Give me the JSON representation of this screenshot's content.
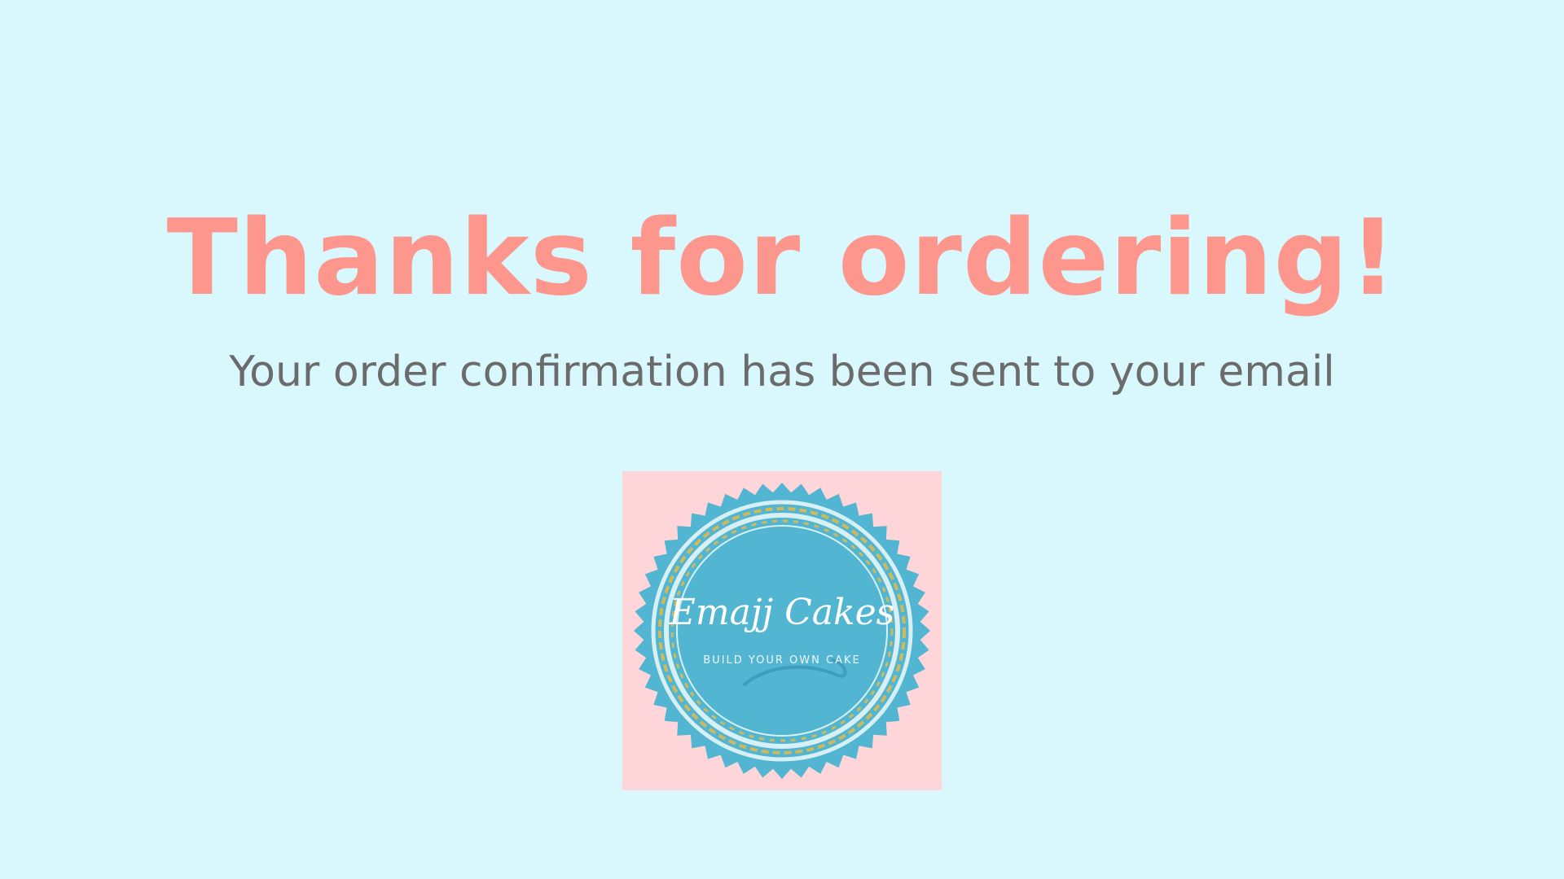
{
  "confirmation": {
    "headline": "Thanks for ordering!",
    "message": "Your order confirmation has been sent to your email"
  },
  "logo": {
    "brand_name": "Emajj Cakes",
    "tagline": "BUILD YOUR OWN CAKE",
    "icon": "cake-badge-logo"
  },
  "colors": {
    "background": "#d9f8fd",
    "headline": "#fd978e",
    "message": "#6c6b6b",
    "logo_card": "#fed5d8",
    "logo_badge": "#52b5d1",
    "logo_ring": "#d7f0f5",
    "logo_gold": "#d1b95a"
  }
}
